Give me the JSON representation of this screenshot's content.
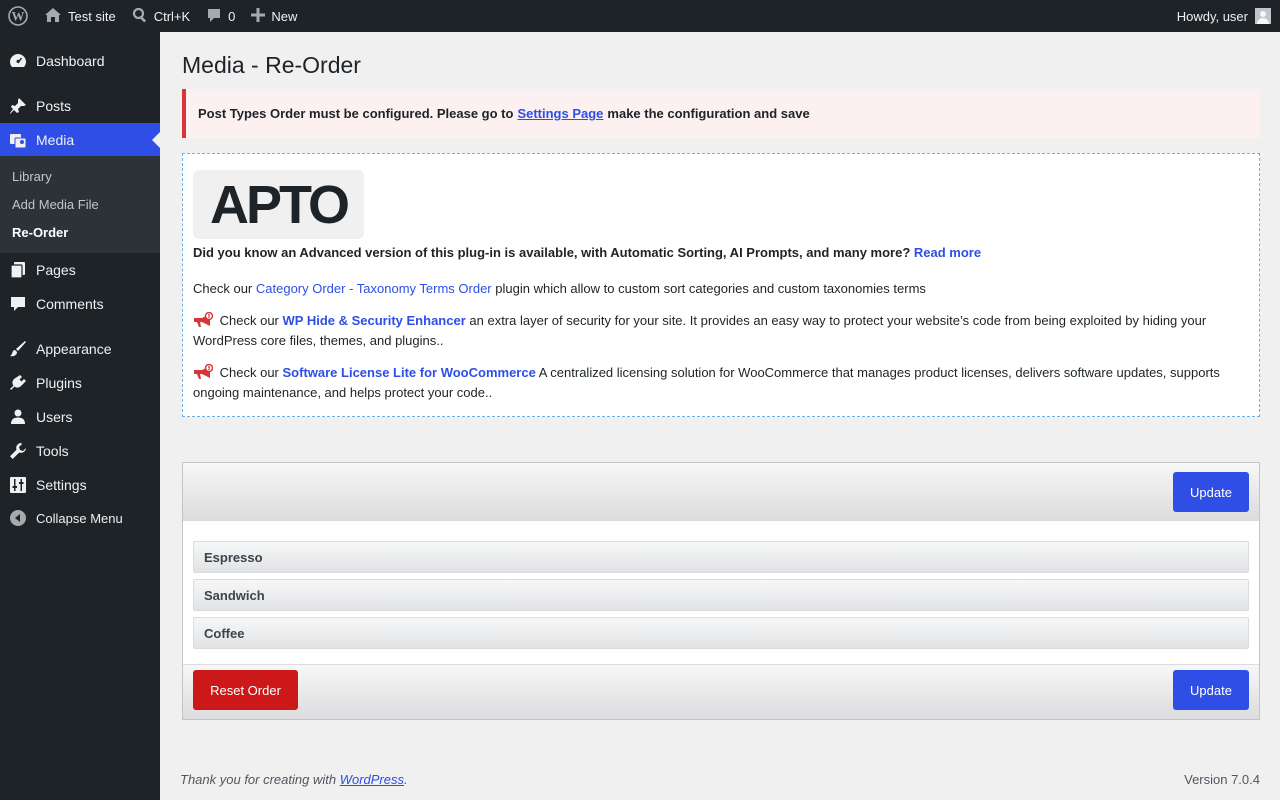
{
  "adminbar": {
    "site_name": "Test site",
    "search_shortcut": "Ctrl+K",
    "comments_count": "0",
    "new_label": "New",
    "greeting": "Howdy, user"
  },
  "sidebar": {
    "items": [
      {
        "label": "Dashboard",
        "icon": "dashboard-icon"
      },
      {
        "label": "Posts",
        "icon": "pin-icon"
      },
      {
        "label": "Media",
        "icon": "media-icon"
      },
      {
        "label": "Pages",
        "icon": "pages-icon"
      },
      {
        "label": "Comments",
        "icon": "comment-icon"
      },
      {
        "label": "Appearance",
        "icon": "brush-icon"
      },
      {
        "label": "Plugins",
        "icon": "plugin-icon"
      },
      {
        "label": "Users",
        "icon": "user-icon"
      },
      {
        "label": "Tools",
        "icon": "wrench-icon"
      },
      {
        "label": "Settings",
        "icon": "sliders-icon"
      }
    ],
    "submenu": [
      "Library",
      "Add Media File",
      "Re-Order"
    ],
    "collapse_label": "Collapse Menu"
  },
  "page": {
    "title": "Media - Re-Order"
  },
  "notice": {
    "before": "Post Types Order must be configured. Please go to",
    "link": "Settings Page",
    "after": "make the configuration and save"
  },
  "promo": {
    "logo_text": "APTO",
    "p1_text": "Did you know an Advanced version of this plug-in is available, with Automatic Sorting, AI Prompts, and many more?",
    "p1_link": "Read more",
    "p2_before": "Check our",
    "p2_link": "Category Order - Taxonomy Terms Order",
    "p2_after": "plugin which allow to custom sort categories and custom taxonomies terms",
    "p3_before": "Check our",
    "p3_link": "WP Hide & Security Enhancer",
    "p3_after": "an extra layer of security for your site. It provides an easy way to protect your website’s code from being exploited by hiding your WordPress core files, themes, and plugins..",
    "p4_before": "Check our",
    "p4_link": "Software License Lite for WooCommerce",
    "p4_after": "A centralized licensing solution for WooCommerce that manages product licenses, delivers software updates, supports ongoing maintenance, and helps protect your code.."
  },
  "reorder": {
    "update_label": "Update",
    "reset_label": "Reset Order",
    "items": [
      "Espresso",
      "Sandwich",
      "Coffee"
    ]
  },
  "footer": {
    "thanks_before": "Thank you for creating with",
    "thanks_link": "WordPress",
    "thanks_after": ".",
    "version": "Version 7.0.4"
  },
  "colors": {
    "accent": "#2e4ee6",
    "danger": "#cc1818",
    "adminbar_bg": "#1d2327"
  }
}
